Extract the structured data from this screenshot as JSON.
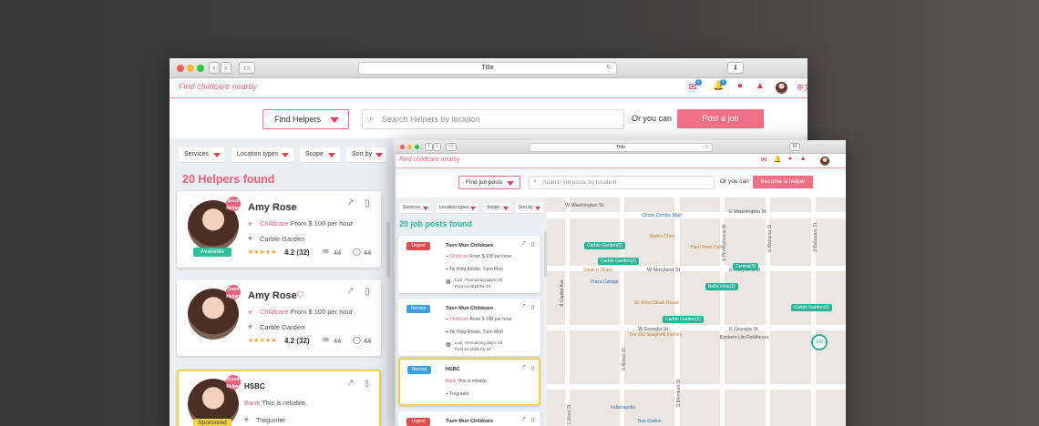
{
  "back_window": {
    "title": "Title",
    "brand": "Find childcare nearby",
    "header": {
      "mail_badge": "1",
      "bell_badge": "1",
      "language": "中文"
    },
    "search": {
      "dropdown_label": "Find Helpers",
      "placeholder": "Search Helpers by location",
      "or_text": "Or you can",
      "action_button": "Post a job"
    },
    "filters": [
      "Services",
      "Location types",
      "Scope",
      "Sort by"
    ],
    "found_title": "20 Helpers found",
    "cards": [
      {
        "name": "Amy Rose",
        "service": "Childcare",
        "price": "From $ 100 per hour",
        "location": "Carble Garden",
        "rating": "4.2 (32)",
        "views": "44",
        "comments": "44",
        "status": "Available",
        "stamp": "Good Helper"
      },
      {
        "name": "Amy Rose",
        "service": "Childcare",
        "price": "From $ 100 per hour",
        "location": "Carble Garden",
        "rating": "4.2 (32)",
        "views": "44",
        "comments": "44",
        "stamp": "Good Helper"
      },
      {
        "name": "HSBC",
        "service": "Bank",
        "price": "This is reliable.",
        "location": "Tregunter",
        "status": "Sponsored",
        "stamp": "Good Helper"
      }
    ]
  },
  "front_window": {
    "title": "Title",
    "brand": "Find childcare nearby",
    "search": {
      "dropdown_label": "Find job posts",
      "placeholder": "Search job posts by location",
      "or_text": "Or you can",
      "action_button": "Become a helper"
    },
    "filters": [
      "Services",
      "Location types",
      "Scope",
      "Sort by"
    ],
    "found_title": "20 job posts found",
    "cards": [
      {
        "tag": "Urgent",
        "title": "Tuen Mun Childcare",
        "service": "Childcare",
        "price": "From $ 100 per hour",
        "location": "Tai Hing Estate, Tuen Mun",
        "live": "Live - Remaining days: 28",
        "post": "Post on 2018-01-24"
      },
      {
        "tag": "Normal",
        "title": "Tuen Mun Childcare",
        "service": "Childcare",
        "price": "From $ 100 per hour",
        "location": "Tai Hing Estate, Tuen Mun",
        "live": "Live - Remaining days: 28",
        "post": "Post on 2018-01-24"
      },
      {
        "tag": "Normal",
        "title": "HSBC",
        "service": "Bank",
        "price": "This is reliable.",
        "location": "Tregunter"
      },
      {
        "tag": "Urgent",
        "title": "Tuen Mun Childcare"
      }
    ],
    "map": {
      "streets": [
        "W Washington St",
        "E Washington St",
        "W Maryland St",
        "E Maryland St",
        "W Georgia St",
        "E Georgia St",
        "S Capitol Ave",
        "S Illinois St",
        "S Meridian St",
        "S Pennsylvania St",
        "S Delaware St",
        "S Alabama St",
        "S West St"
      ],
      "pins": [
        "Carble Garden(2)",
        "Carble Garden(2)",
        "Central(2)",
        "Bella Vista(2)",
        "Carble Garden(2)",
        "Carble Garden(2)"
      ],
      "pois": [
        "Circle Centre Mall",
        "Ruth's Chris",
        "Hard Rock Cafe",
        "Steak n Shake",
        "Plaza Garage",
        "St. Elmo Steak House",
        "The Old Spaghetti Factory",
        "Bankers Life Fieldhouse",
        "Indianapolis",
        "Bus Station"
      ],
      "cluster": "100"
    }
  },
  "colors": {
    "brand_pink": "#f26b82",
    "accent_green": "#2bb39a",
    "normal_blue": "#3b9ee6",
    "urgent_red": "#e24b4b",
    "sponsored_yellow": "#f4d34b"
  }
}
